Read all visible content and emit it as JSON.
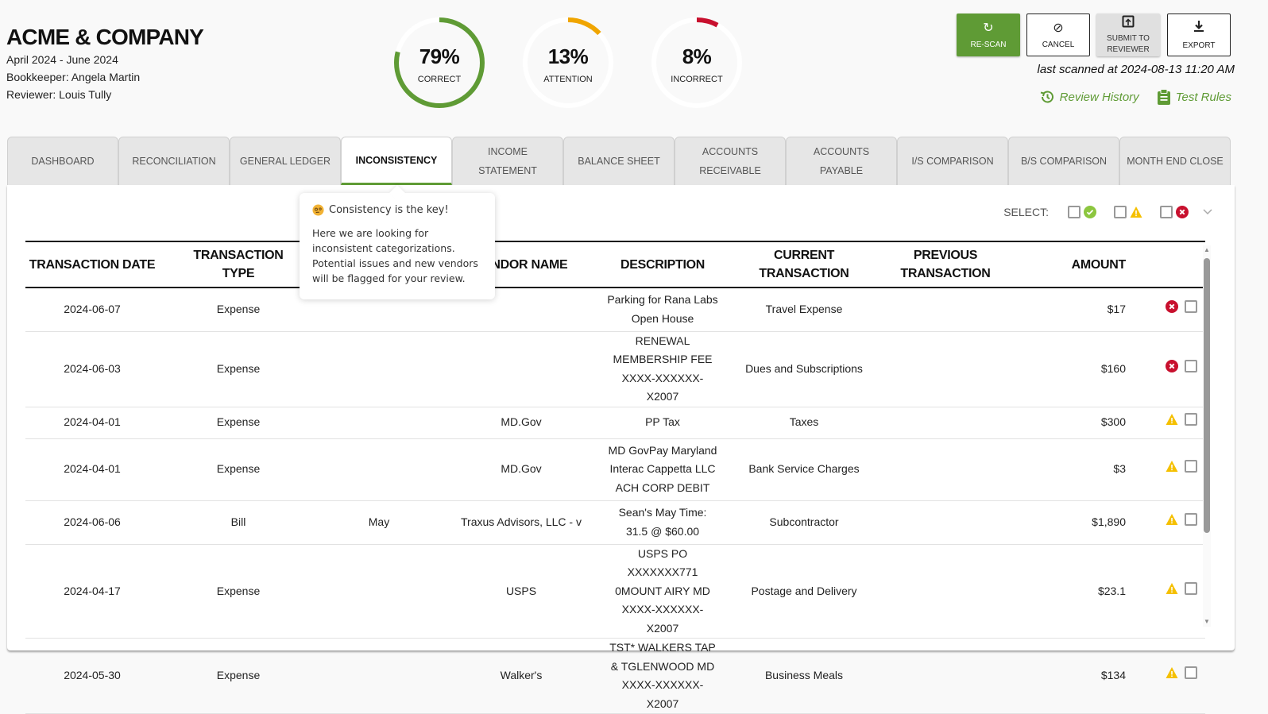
{
  "company": {
    "name": "ACME & COMPANY",
    "period": "April 2024 - June 2024",
    "bookkeeper": "Bookkeeper: Angela Martin",
    "reviewer": "Reviewer: Louis Tully"
  },
  "gauges": [
    {
      "value": 79,
      "label_pct": "79%",
      "label": "CORRECT",
      "color": "#5f9b35"
    },
    {
      "value": 13,
      "label_pct": "13%",
      "label": "ATTENTION",
      "color": "#f0a500"
    },
    {
      "value": 8,
      "label_pct": "8%",
      "label": "INCORRECT",
      "color": "#c8102e"
    }
  ],
  "actions": {
    "rescan": "RE-SCAN",
    "cancel": "CANCEL",
    "submit": "SUBMIT TO REVIEWER",
    "export": "EXPORT"
  },
  "last_scanned": "last scanned at 2024-08-13 11:20 AM",
  "links": {
    "review_history": "Review History",
    "test_rules": "Test Rules"
  },
  "tabs": [
    {
      "label": "DASHBOARD",
      "active": false
    },
    {
      "label": "RECONCILIATION",
      "active": false
    },
    {
      "label": "GENERAL LEDGER",
      "active": false
    },
    {
      "label": "INCONSISTENCY",
      "active": true
    },
    {
      "label": "INCOME STATEMENT",
      "active": false
    },
    {
      "label": "BALANCE SHEET",
      "active": false
    },
    {
      "label": "ACCOUNTS RECEIVABLE",
      "active": false
    },
    {
      "label": "ACCOUNTS PAYABLE",
      "active": false
    },
    {
      "label": "I/S COMPARISON",
      "active": false
    },
    {
      "label": "B/S COMPARISON",
      "active": false
    },
    {
      "label": "MONTH END CLOSE",
      "active": false
    }
  ],
  "tooltip": {
    "title": "Consistency is the key!",
    "body": "Here we are looking for inconsistent categorizations. Potential issues and new vendors will be flagged for your review."
  },
  "select": {
    "label": "SELECT:",
    "options": [
      "correct",
      "attention",
      "incorrect"
    ]
  },
  "colors": {
    "green": "#5f9b35",
    "check_green": "#8cc63f",
    "warning": "#f5c000",
    "error": "#c8102e"
  },
  "table": {
    "headers": [
      "TRANSACTION DATE",
      "TRANSACTION TYPE",
      "",
      "VENDOR NAME",
      "DESCRIPTION",
      "CURRENT TRANSACTION",
      "PREVIOUS TRANSACTION",
      "AMOUNT",
      ""
    ],
    "rows": [
      {
        "date": "2024-06-07",
        "type": "Expense",
        "extra": "",
        "vendor": "",
        "description": "Parking for Rana Labs Open House",
        "current": "Travel Expense",
        "previous": "",
        "amount": "$17",
        "status": "error"
      },
      {
        "date": "2024-06-03",
        "type": "Expense",
        "extra": "",
        "vendor": "",
        "description": "RENEWAL MEMBERSHIP FEE XXXX-XXXXXX-X2007",
        "current": "Dues and Subscriptions",
        "previous": "",
        "amount": "$160",
        "status": "error"
      },
      {
        "date": "2024-04-01",
        "type": "Expense",
        "extra": "",
        "vendor": "MD.Gov",
        "description": "PP Tax",
        "current": "Taxes",
        "previous": "",
        "amount": "$300",
        "status": "warning"
      },
      {
        "date": "2024-04-01",
        "type": "Expense",
        "extra": "",
        "vendor": "MD.Gov",
        "description": "MD GovPay Maryland Interac Cappetta LLC ACH CORP DEBIT",
        "current": "Bank Service Charges",
        "previous": "",
        "amount": "$3",
        "status": "warning"
      },
      {
        "date": "2024-06-06",
        "type": "Bill",
        "extra": "May",
        "vendor": "Traxus Advisors, LLC - v",
        "description": "Sean's May Time: 31.5 @ $60.00",
        "current": "Subcontractor",
        "previous": "",
        "amount": "$1,890",
        "status": "warning"
      },
      {
        "date": "2024-04-17",
        "type": "Expense",
        "extra": "",
        "vendor": "USPS",
        "description": "USPS PO XXXXXXX771 0MOUNT AIRY MD XXXX-XXXXXX-X2007",
        "current": "Postage and Delivery",
        "previous": "",
        "amount": "$23.1",
        "status": "warning"
      },
      {
        "date": "2024-05-30",
        "type": "Expense",
        "extra": "",
        "vendor": "Walker's",
        "description": "TST* WALKERS TAP & TGLENWOOD MD XXXX-XXXXXX-X2007",
        "current": "Business Meals",
        "previous": "",
        "amount": "$134",
        "status": "warning"
      }
    ]
  }
}
